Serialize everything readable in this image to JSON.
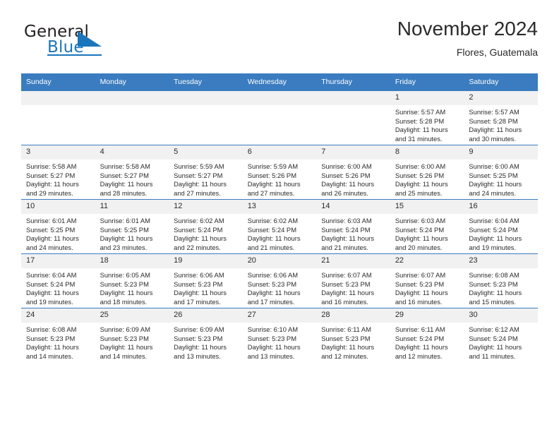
{
  "brand": {
    "name_part1": "General",
    "name_part2": "Blue",
    "logo_icon": "triangle-logo-icon",
    "accent_color": "#1b75bb"
  },
  "header": {
    "title": "November 2024",
    "subtitle": "Flores, Guatemala"
  },
  "calendar": {
    "header_bg": "#3a7cbf",
    "daynum_bg": "#f1f1f1",
    "weekday_headers": [
      "Sunday",
      "Monday",
      "Tuesday",
      "Wednesday",
      "Thursday",
      "Friday",
      "Saturday"
    ],
    "weeks": [
      [
        {
          "day": "",
          "sunrise": "",
          "sunset": "",
          "daylight": ""
        },
        {
          "day": "",
          "sunrise": "",
          "sunset": "",
          "daylight": ""
        },
        {
          "day": "",
          "sunrise": "",
          "sunset": "",
          "daylight": ""
        },
        {
          "day": "",
          "sunrise": "",
          "sunset": "",
          "daylight": ""
        },
        {
          "day": "",
          "sunrise": "",
          "sunset": "",
          "daylight": ""
        },
        {
          "day": "1",
          "sunrise": "Sunrise: 5:57 AM",
          "sunset": "Sunset: 5:28 PM",
          "daylight": "Daylight: 11 hours and 31 minutes."
        },
        {
          "day": "2",
          "sunrise": "Sunrise: 5:57 AM",
          "sunset": "Sunset: 5:28 PM",
          "daylight": "Daylight: 11 hours and 30 minutes."
        }
      ],
      [
        {
          "day": "3",
          "sunrise": "Sunrise: 5:58 AM",
          "sunset": "Sunset: 5:27 PM",
          "daylight": "Daylight: 11 hours and 29 minutes."
        },
        {
          "day": "4",
          "sunrise": "Sunrise: 5:58 AM",
          "sunset": "Sunset: 5:27 PM",
          "daylight": "Daylight: 11 hours and 28 minutes."
        },
        {
          "day": "5",
          "sunrise": "Sunrise: 5:59 AM",
          "sunset": "Sunset: 5:27 PM",
          "daylight": "Daylight: 11 hours and 27 minutes."
        },
        {
          "day": "6",
          "sunrise": "Sunrise: 5:59 AM",
          "sunset": "Sunset: 5:26 PM",
          "daylight": "Daylight: 11 hours and 27 minutes."
        },
        {
          "day": "7",
          "sunrise": "Sunrise: 6:00 AM",
          "sunset": "Sunset: 5:26 PM",
          "daylight": "Daylight: 11 hours and 26 minutes."
        },
        {
          "day": "8",
          "sunrise": "Sunrise: 6:00 AM",
          "sunset": "Sunset: 5:26 PM",
          "daylight": "Daylight: 11 hours and 25 minutes."
        },
        {
          "day": "9",
          "sunrise": "Sunrise: 6:00 AM",
          "sunset": "Sunset: 5:25 PM",
          "daylight": "Daylight: 11 hours and 24 minutes."
        }
      ],
      [
        {
          "day": "10",
          "sunrise": "Sunrise: 6:01 AM",
          "sunset": "Sunset: 5:25 PM",
          "daylight": "Daylight: 11 hours and 24 minutes."
        },
        {
          "day": "11",
          "sunrise": "Sunrise: 6:01 AM",
          "sunset": "Sunset: 5:25 PM",
          "daylight": "Daylight: 11 hours and 23 minutes."
        },
        {
          "day": "12",
          "sunrise": "Sunrise: 6:02 AM",
          "sunset": "Sunset: 5:24 PM",
          "daylight": "Daylight: 11 hours and 22 minutes."
        },
        {
          "day": "13",
          "sunrise": "Sunrise: 6:02 AM",
          "sunset": "Sunset: 5:24 PM",
          "daylight": "Daylight: 11 hours and 21 minutes."
        },
        {
          "day": "14",
          "sunrise": "Sunrise: 6:03 AM",
          "sunset": "Sunset: 5:24 PM",
          "daylight": "Daylight: 11 hours and 21 minutes."
        },
        {
          "day": "15",
          "sunrise": "Sunrise: 6:03 AM",
          "sunset": "Sunset: 5:24 PM",
          "daylight": "Daylight: 11 hours and 20 minutes."
        },
        {
          "day": "16",
          "sunrise": "Sunrise: 6:04 AM",
          "sunset": "Sunset: 5:24 PM",
          "daylight": "Daylight: 11 hours and 19 minutes."
        }
      ],
      [
        {
          "day": "17",
          "sunrise": "Sunrise: 6:04 AM",
          "sunset": "Sunset: 5:24 PM",
          "daylight": "Daylight: 11 hours and 19 minutes."
        },
        {
          "day": "18",
          "sunrise": "Sunrise: 6:05 AM",
          "sunset": "Sunset: 5:23 PM",
          "daylight": "Daylight: 11 hours and 18 minutes."
        },
        {
          "day": "19",
          "sunrise": "Sunrise: 6:06 AM",
          "sunset": "Sunset: 5:23 PM",
          "daylight": "Daylight: 11 hours and 17 minutes."
        },
        {
          "day": "20",
          "sunrise": "Sunrise: 6:06 AM",
          "sunset": "Sunset: 5:23 PM",
          "daylight": "Daylight: 11 hours and 17 minutes."
        },
        {
          "day": "21",
          "sunrise": "Sunrise: 6:07 AM",
          "sunset": "Sunset: 5:23 PM",
          "daylight": "Daylight: 11 hours and 16 minutes."
        },
        {
          "day": "22",
          "sunrise": "Sunrise: 6:07 AM",
          "sunset": "Sunset: 5:23 PM",
          "daylight": "Daylight: 11 hours and 16 minutes."
        },
        {
          "day": "23",
          "sunrise": "Sunrise: 6:08 AM",
          "sunset": "Sunset: 5:23 PM",
          "daylight": "Daylight: 11 hours and 15 minutes."
        }
      ],
      [
        {
          "day": "24",
          "sunrise": "Sunrise: 6:08 AM",
          "sunset": "Sunset: 5:23 PM",
          "daylight": "Daylight: 11 hours and 14 minutes."
        },
        {
          "day": "25",
          "sunrise": "Sunrise: 6:09 AM",
          "sunset": "Sunset: 5:23 PM",
          "daylight": "Daylight: 11 hours and 14 minutes."
        },
        {
          "day": "26",
          "sunrise": "Sunrise: 6:09 AM",
          "sunset": "Sunset: 5:23 PM",
          "daylight": "Daylight: 11 hours and 13 minutes."
        },
        {
          "day": "27",
          "sunrise": "Sunrise: 6:10 AM",
          "sunset": "Sunset: 5:23 PM",
          "daylight": "Daylight: 11 hours and 13 minutes."
        },
        {
          "day": "28",
          "sunrise": "Sunrise: 6:11 AM",
          "sunset": "Sunset: 5:23 PM",
          "daylight": "Daylight: 11 hours and 12 minutes."
        },
        {
          "day": "29",
          "sunrise": "Sunrise: 6:11 AM",
          "sunset": "Sunset: 5:24 PM",
          "daylight": "Daylight: 11 hours and 12 minutes."
        },
        {
          "day": "30",
          "sunrise": "Sunrise: 6:12 AM",
          "sunset": "Sunset: 5:24 PM",
          "daylight": "Daylight: 11 hours and 11 minutes."
        }
      ]
    ]
  }
}
